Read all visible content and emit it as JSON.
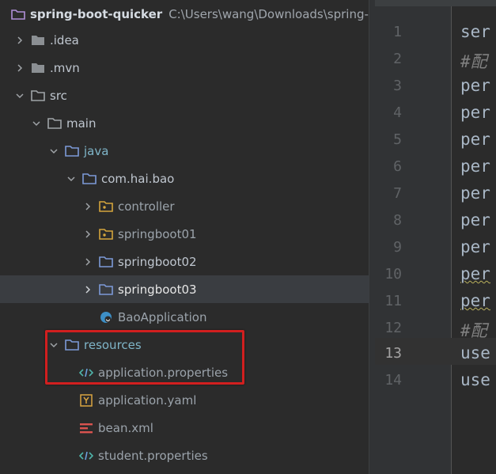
{
  "tree": {
    "root": {
      "name": "spring-boot-quicker",
      "path": "C:\\Users\\wang\\Downloads\\spring-boo"
    },
    "items": [
      {
        "label": ".idea"
      },
      {
        "label": ".mvn"
      },
      {
        "label": "src"
      },
      {
        "label": "main"
      },
      {
        "label": "java"
      },
      {
        "label": "com.hai.bao"
      },
      {
        "label": "controller"
      },
      {
        "label": "springboot01"
      },
      {
        "label": "springboot02"
      },
      {
        "label": "springboot03"
      },
      {
        "label": "BaoApplication"
      },
      {
        "label": "resources"
      },
      {
        "label": "application.properties"
      },
      {
        "label": "application.yaml"
      },
      {
        "label": "bean.xml"
      },
      {
        "label": "student.properties"
      }
    ]
  },
  "editor": {
    "line_numbers": [
      "1",
      "2",
      "3",
      "4",
      "5",
      "6",
      "7",
      "8",
      "9",
      "10",
      "11",
      "12",
      "13",
      "14"
    ],
    "lines": [
      "ser",
      "#配",
      "per",
      "per",
      "per",
      "per",
      "per",
      "per",
      "per",
      "per",
      "per",
      "#配",
      "use",
      "use"
    ]
  },
  "colors": {
    "highlight": "#d11f1f",
    "folder": "#7c9ad8",
    "package_folder": "#d4a53c"
  }
}
